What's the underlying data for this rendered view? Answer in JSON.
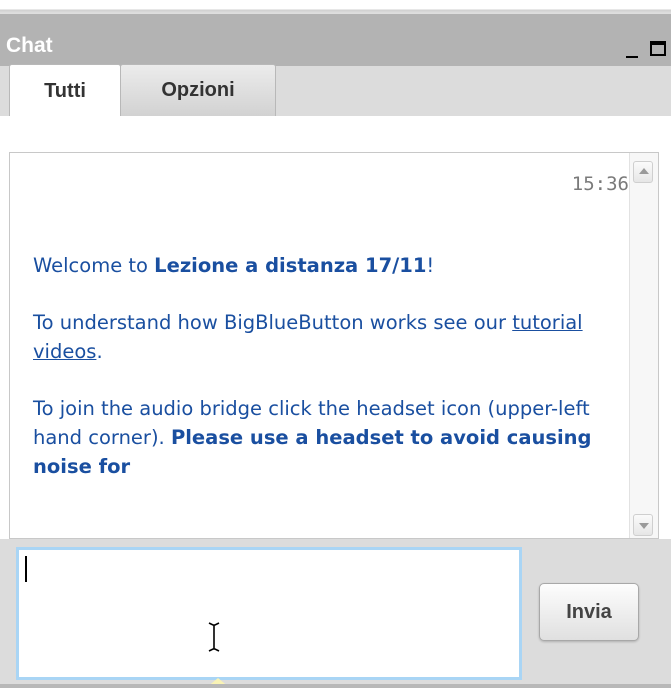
{
  "window": {
    "title": "Chat",
    "minimize_icon": "minimize-icon",
    "maximize_icon": "maximize-icon"
  },
  "tabs": [
    {
      "label": "Tutti",
      "active": true
    },
    {
      "label": "Opzioni",
      "active": false
    }
  ],
  "chat": {
    "timestamp": "15:36",
    "welcome_prefix": "Welcome to ",
    "welcome_room": "Lezione a distanza 17/11",
    "welcome_suffix": "!",
    "tutorial_prefix": "To understand how BigBlueButton works see our ",
    "tutorial_link": "tutorial videos",
    "tutorial_suffix": ".",
    "audio_text": "To join the audio bridge click the headset icon (upper-left hand corner). ",
    "audio_bold": "Please use a headset to avoid causing noise for"
  },
  "input": {
    "value": ""
  },
  "send_button": {
    "label": "Invia"
  },
  "colors": {
    "message_text": "#1a4fa0",
    "titlebar": "#b3b3b3",
    "input_focus": "#a9d5f5"
  }
}
